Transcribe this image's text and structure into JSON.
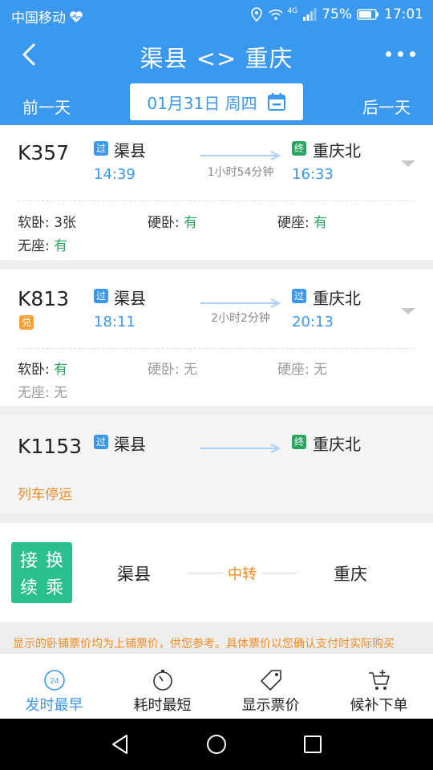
{
  "status_bar": {
    "carrier": "中国移动",
    "network": "4G",
    "battery": "75%",
    "time": "17:01"
  },
  "header": {
    "title": "渠县 <> 重庆",
    "prev_day": "前一天",
    "next_day": "后一天",
    "date": "01月31日 周四"
  },
  "trains": [
    {
      "number": "K357",
      "from_tag": "过",
      "from_station": "渠县",
      "depart_time": "14:39",
      "duration": "1小时54分钟",
      "to_tag": "终",
      "to_station": "重庆北",
      "arrive_time": "16:33",
      "seats": [
        {
          "label": "软卧: ",
          "value": "3张"
        },
        {
          "label": "硬卧: ",
          "value": "有"
        },
        {
          "label": "硬座: ",
          "value": "有"
        },
        {
          "label": "无座: ",
          "value": "有"
        }
      ]
    },
    {
      "number": "K813",
      "badge": "兑",
      "from_tag": "过",
      "from_station": "渠县",
      "depart_time": "18:11",
      "duration": "2小时2分钟",
      "to_tag": "过",
      "to_station": "重庆北",
      "arrive_time": "20:13",
      "seats": [
        {
          "label": "软卧: ",
          "value": "有"
        },
        {
          "label": "硬卧: ",
          "value": "无"
        },
        {
          "label": "硬座: ",
          "value": "无"
        },
        {
          "label": "无座: ",
          "value": "无"
        }
      ]
    },
    {
      "number": "K1153",
      "from_tag": "过",
      "from_station": "渠县",
      "to_tag": "终",
      "to_station": "重庆北",
      "status": "列车停运"
    }
  ],
  "transfer": {
    "badge": [
      "接",
      "换",
      "续",
      "乘"
    ],
    "from": "渠县",
    "middle": "中转",
    "to": "重庆"
  },
  "notice": "显示的卧铺票价均为上铺票价，供您参考。具体票价以您确认支付时实际购买",
  "bottom_tabs": [
    {
      "label": "发时最早",
      "icon": "clock-24-icon",
      "badge": "24"
    },
    {
      "label": "耗时最短",
      "icon": "timer-icon"
    },
    {
      "label": "显示票价",
      "icon": "price-tag-icon"
    },
    {
      "label": "候补下单",
      "icon": "cart-add-icon"
    }
  ],
  "colors": {
    "primary": "#3b98ef",
    "green": "#2aa55d",
    "orange": "#f08a24",
    "transfer_badge": "#2cbf8e"
  }
}
